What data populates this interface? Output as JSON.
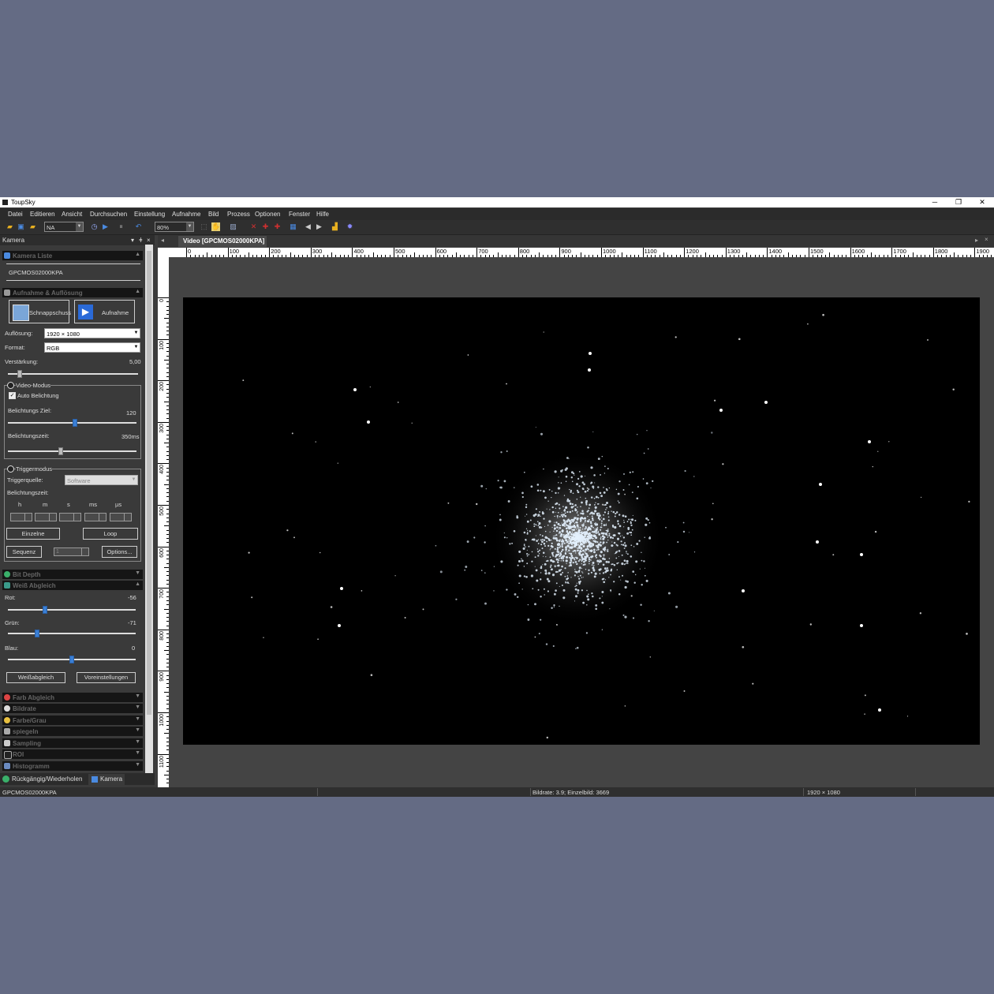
{
  "window": {
    "title": "ToupSky"
  },
  "menu": [
    "Datei",
    "Editieren",
    "Ansicht",
    "Durchsuchen",
    "Einstellung",
    "Aufnahme",
    "Bild",
    "Prozess",
    "Optionen",
    "Fenster",
    "Hilfe"
  ],
  "toolbar": {
    "combo1": "NA",
    "zoom": "80%"
  },
  "left_panel": {
    "title": "Kamera",
    "camera_list": {
      "header": "Kamera Liste",
      "camera": "GPCMOS02000KPA"
    },
    "capture": {
      "header": "Aufnahme & Auflösung",
      "snapshot_label": "Schnappschuss",
      "record_label": "Aufnahme",
      "resolution_label": "Auflösung:",
      "resolution_value": "1920 × 1080",
      "format_label": "Format:",
      "format_value": "RGB",
      "gain_label": "Verstärkung:",
      "gain_value": "5,00",
      "gain_fraction": 0.09
    },
    "video_mode": {
      "label": "Video-Modus",
      "auto_exposure_label": "Auto Belichtung",
      "target_label": "Belichtungs Ziel:",
      "target_value": "120",
      "target_fraction": 0.52,
      "time_label": "Belichtungszeit:",
      "time_value": "350ms",
      "time_fraction": 0.41
    },
    "trigger": {
      "label": "Triggermodus",
      "source_label": "Triggerquelle:",
      "source_value": "Software",
      "time_label": "Belichtungszeit:",
      "units": [
        "h",
        "m",
        "s",
        "ms",
        "µs"
      ],
      "single_label": "Einzelne",
      "loop_label": "Loop",
      "sequence_label": "Sequenz",
      "sequence_value": "1",
      "options_label": "Options..."
    },
    "bit_depth": {
      "header": "Bit Depth"
    },
    "white_balance": {
      "header": "Weiß Abgleich",
      "red_label": "Rot:",
      "red_value": "-56",
      "red_fraction": 0.29,
      "green_label": "Grün:",
      "green_value": "-71",
      "green_fraction": 0.23,
      "blue_label": "Blau:",
      "blue_value": "0",
      "blue_fraction": 0.5,
      "wb_button": "Weißabgleich",
      "defaults_button": "Voreinstellungen"
    },
    "more_sections": [
      "Farb Abgleich",
      "Bildrate",
      "Farbe/Grau",
      "spiegeln",
      "Sampling",
      "ROI",
      "Histogramm"
    ],
    "bottom_tabs": [
      "Rückgängig/Wiederholen",
      "Kamera"
    ]
  },
  "video": {
    "tab_title": "Video [GPCMOS02000KPA]",
    "h_ruler": [
      "0",
      "100",
      "200",
      "300",
      "400",
      "500",
      "600",
      "700",
      "800",
      "900",
      "1000",
      "1100",
      "1200",
      "1300",
      "1400",
      "1500",
      "1600",
      "1700",
      "1800",
      "1900"
    ],
    "v_ruler": [
      "0",
      "100",
      "200",
      "300",
      "400",
      "500",
      "600",
      "700",
      "800",
      "900",
      "1000",
      "1100"
    ]
  },
  "status": {
    "camera": "GPCMOS02000KPA",
    "framerate": "Bildrate: 3.9; Einzelbild: 3669",
    "resolution": "1920 × 1080"
  },
  "colors": {
    "accent": "#3a7fd5",
    "background": "#646b84"
  }
}
